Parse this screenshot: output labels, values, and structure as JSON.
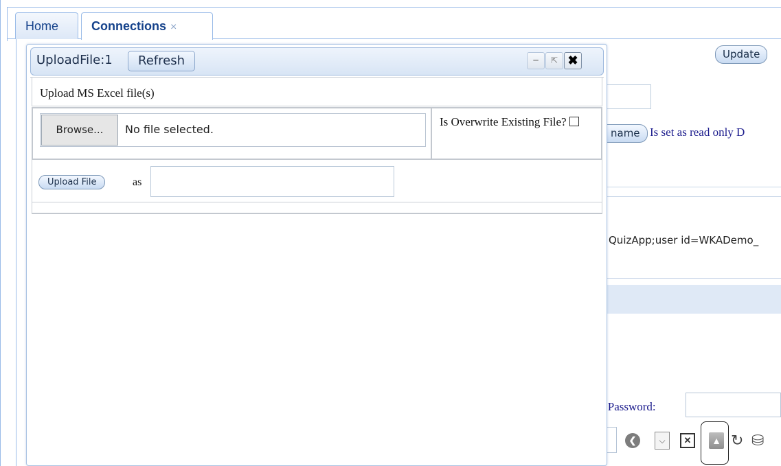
{
  "tabs": [
    {
      "label": "Home"
    },
    {
      "label": "Connections",
      "close": "×"
    }
  ],
  "background": {
    "update_label": "Update",
    "name_button_label": "name",
    "readonly_text": "Is set as read only D",
    "connection_text": "QuizApp;user id=WKADemo_",
    "password_label": "v Password:",
    "password_value": ""
  },
  "dialog": {
    "title": "UploadFile:1",
    "refresh_label": "Refresh",
    "window_buttons": {
      "minimize": "–",
      "popout": "⇱",
      "close": "✖"
    },
    "section_label": "Upload MS Excel file(s)",
    "browse_label": "Browse...",
    "file_status": "No file selected.",
    "overwrite_label": "Is Overwrite Existing File?",
    "overwrite_checked": false,
    "upload_button_label": "Upload File",
    "as_label": "as",
    "as_value": ""
  },
  "pager": {
    "icons": [
      "prev-icon",
      "dropdown-icon",
      "delete-icon",
      "upload-icon",
      "refresh-icon",
      "database-icon"
    ]
  }
}
